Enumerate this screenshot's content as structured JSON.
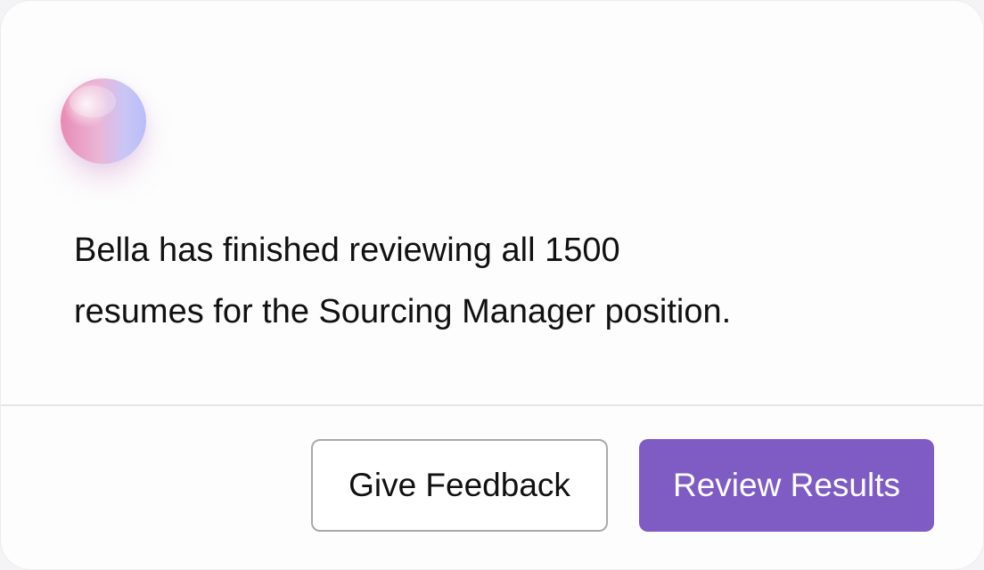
{
  "notification": {
    "message_line1": "Bella has finished reviewing all 1500",
    "message_line2": "resumes for the Sourcing Manager position.",
    "avatar_icon": "assistant-orb"
  },
  "actions": {
    "feedback_label": "Give Feedback",
    "review_label": "Review Results"
  },
  "colors": {
    "primary": "#7F5BC4",
    "card_background": "#FDFDFD",
    "divider": "#E6E6E8",
    "secondary_border": "#A9A9AD"
  }
}
